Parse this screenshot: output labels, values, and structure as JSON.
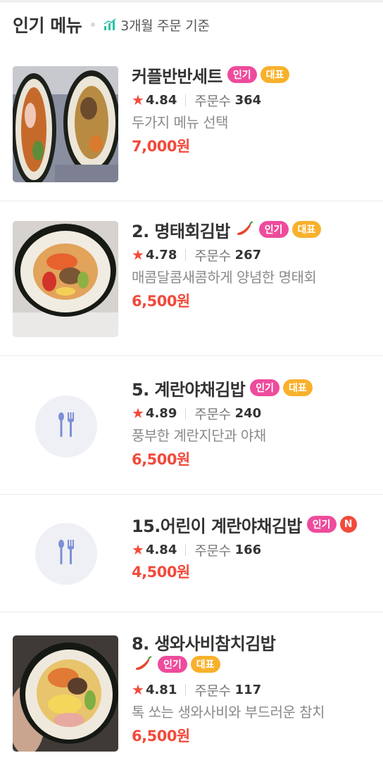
{
  "header": {
    "title": "인기 메뉴",
    "basis": "3개월 주문 기준"
  },
  "badges": {
    "popular": "인기",
    "signature": "대표",
    "new": "N"
  },
  "labels": {
    "orders": "주문수"
  },
  "colors": {
    "accent_red": "#f24a3b",
    "badge_popular": "#ee4b9c",
    "badge_signature": "#f8b12c"
  },
  "menu": [
    {
      "name": "커플반반세트",
      "rating": "4.84",
      "orders": "364",
      "description": "두가지 메뉴 선택",
      "price": "7,000원"
    },
    {
      "name": "2. 명태회김밥",
      "rating": "4.78",
      "orders": "267",
      "description": "매콤달콤새콤하게 양념한 명태회",
      "price": "6,500원"
    },
    {
      "name": "5. 계란야채김밥",
      "rating": "4.89",
      "orders": "240",
      "description": "풍부한 계란지단과 야채",
      "price": "6,500원"
    },
    {
      "name": "15.어린이 계란야채김밥",
      "rating": "4.84",
      "orders": "166",
      "price": "4,500원"
    },
    {
      "name": "8. 생와사비참치김밥",
      "rating": "4.81",
      "orders": "117",
      "description": "톡 쏘는 생와사비와 부드러운 참치",
      "price": "6,500원"
    }
  ]
}
